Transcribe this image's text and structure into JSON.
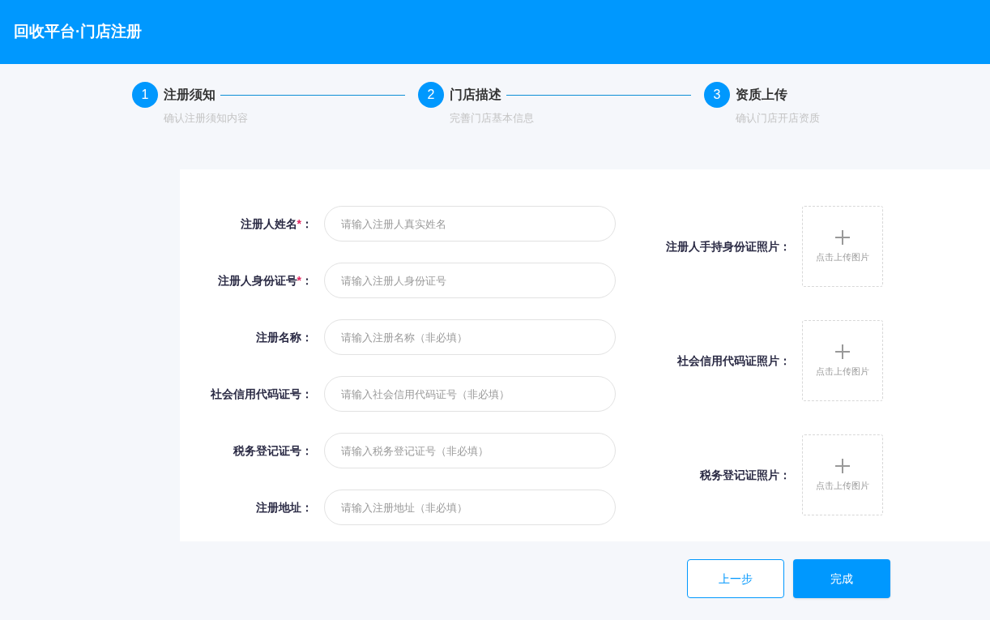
{
  "header": {
    "title": "回收平台·门店注册"
  },
  "steps": [
    {
      "number": "1",
      "title": "注册须知",
      "subtitle": "确认注册须知内容"
    },
    {
      "number": "2",
      "title": "门店描述",
      "subtitle": "完善门店基本信息"
    },
    {
      "number": "3",
      "title": "资质上传",
      "subtitle": "确认门店开店资质"
    }
  ],
  "fields": [
    {
      "label": "注册人姓名",
      "required_mark": "*",
      "colon": "：",
      "placeholder": "请输入注册人真实姓名"
    },
    {
      "label": "注册人身份证号",
      "required_mark": "*",
      "colon": "：",
      "placeholder": "请输入注册人身份证号"
    },
    {
      "label": "注册名称",
      "colon": "：",
      "placeholder": "请输入注册名称（非必填）"
    },
    {
      "label": "社会信用代码证号",
      "colon": "：",
      "placeholder": "请输入社会信用代码证号（非必填）"
    },
    {
      "label": "税务登记证号",
      "colon": "：",
      "placeholder": "请输入税务登记证号（非必填）"
    },
    {
      "label": "注册地址",
      "colon": "：",
      "placeholder": "请输入注册地址（非必填）"
    }
  ],
  "uploads": [
    {
      "label": "注册人手持身份证照片：",
      "hint": "点击上传图片"
    },
    {
      "label": "社会信用代码证照片：",
      "hint": "点击上传图片"
    },
    {
      "label": "税务登记证照片：",
      "hint": "点击上传图片"
    }
  ],
  "buttons": [
    {
      "label": "上一步",
      "kind": "outline"
    },
    {
      "label": "完成",
      "kind": "primary"
    }
  ]
}
